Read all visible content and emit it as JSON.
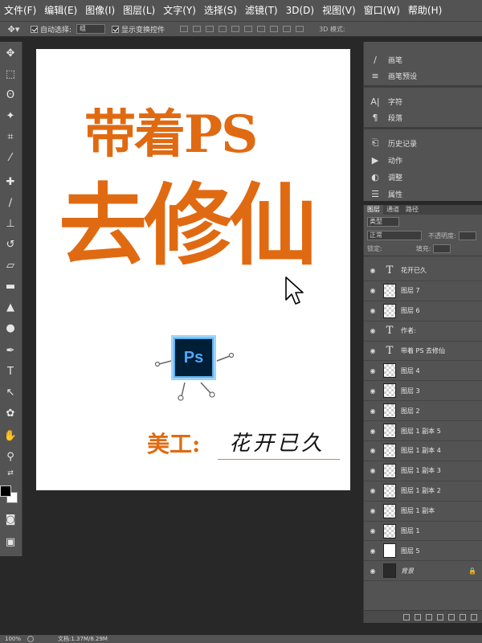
{
  "menu": [
    "文件(F)",
    "编辑(E)",
    "图像(I)",
    "图层(L)",
    "文字(Y)",
    "选择(S)",
    "滤镜(T)",
    "3D(D)",
    "视图(V)",
    "窗口(W)",
    "帮助(H)"
  ],
  "options_bar": {
    "auto_select_label": "自动选择:",
    "auto_select_value": "组",
    "show_transform_label": "显示变换控件",
    "mode_3d_label": "3D 模式:"
  },
  "canvas": {
    "title_line1": "带着PS",
    "title_line2": "去修仙",
    "logo_text": "Ps",
    "designer_label": "美工:",
    "designer_name": "花开已久",
    "accent_color": "#e06a12"
  },
  "right_panels": [
    {
      "icon": "brush-icon",
      "label": "画笔"
    },
    {
      "icon": "brush-preset-icon",
      "label": "画笔预设"
    },
    {
      "icon": "character-icon",
      "label": "字符"
    },
    {
      "icon": "paragraph-icon",
      "label": "段落"
    },
    {
      "icon": "history-icon",
      "label": "历史记录"
    },
    {
      "icon": "actions-icon",
      "label": "动作"
    },
    {
      "icon": "adjustments-icon",
      "label": "调整"
    },
    {
      "icon": "properties-icon",
      "label": "属性"
    }
  ],
  "layers_panel": {
    "tabs": [
      "图层",
      "通道",
      "路径"
    ],
    "filter_kind": "类型",
    "blend_mode": "正常",
    "opacity_label": "不透明度:",
    "fill_label": "填充:",
    "lock_label": "锁定:",
    "layers": [
      {
        "name": "花开已久",
        "type": "text"
      },
      {
        "name": "图层 7",
        "type": "pixel"
      },
      {
        "name": "图层 6",
        "type": "pixel"
      },
      {
        "name": "作者:",
        "type": "text"
      },
      {
        "name": "带着 PS 去修仙",
        "type": "text"
      },
      {
        "name": "图层 4",
        "type": "pixel"
      },
      {
        "name": "图层 3",
        "type": "pixel"
      },
      {
        "name": "图层 2",
        "type": "pixel"
      },
      {
        "name": "图层 1 副本 5",
        "type": "pixel"
      },
      {
        "name": "图层 1 副本 4",
        "type": "pixel"
      },
      {
        "name": "图层 1 副本 3",
        "type": "pixel"
      },
      {
        "name": "图层 1 副本 2",
        "type": "pixel"
      },
      {
        "name": "图层 1 副本",
        "type": "pixel"
      },
      {
        "name": "图层 1",
        "type": "pixel"
      },
      {
        "name": "图层 5",
        "type": "white"
      },
      {
        "name": "背景",
        "type": "background"
      }
    ]
  },
  "status_bar": {
    "zoom": "100%",
    "doc_info": "文档:1.37M/8.29M"
  }
}
